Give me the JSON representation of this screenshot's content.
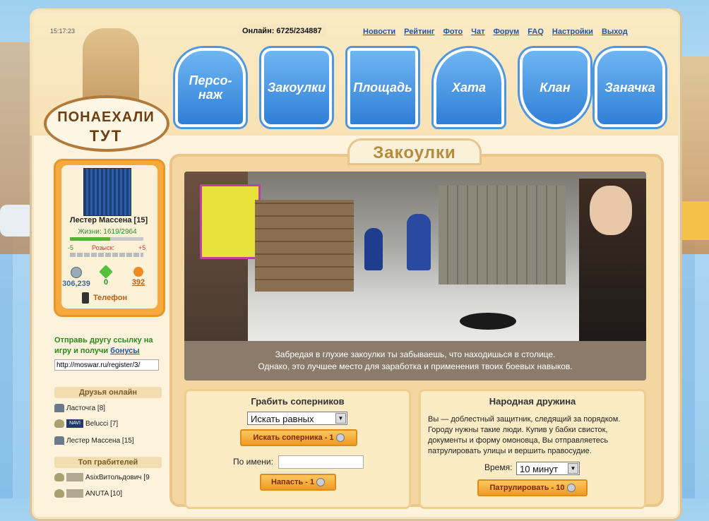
{
  "header": {
    "clock": "15:17:23",
    "online": "Онлайн: 6725/234887",
    "logo_line1": "ПОНАЕХАЛИ",
    "logo_line2": "ТУТ",
    "nav": [
      "Новости",
      "Рейтинг",
      "Фото",
      "Чат",
      "Форум",
      "FAQ",
      "Настройки",
      "Выход"
    ]
  },
  "badges": [
    "Персо-наж",
    "Закоулки",
    "Площадь",
    "Хата",
    "Клан",
    "Заначка"
  ],
  "character": {
    "name": "Лестер Массена [15]",
    "hp_label": "Жизни: 1619/2964",
    "hp_fraction": 0.546,
    "wanted_min": "-5",
    "wanted_label": "Розыск:",
    "wanted_max": "+5",
    "money": "306,239",
    "ore": "0",
    "oil": "392",
    "phone": "Телефон"
  },
  "invite": {
    "text": "Отправь другу ссылку на игру и получи",
    "link": "бонусы",
    "url": "http://moswar.ru/register/3/"
  },
  "friends": {
    "title": "Друзья онлайн",
    "items": [
      {
        "name": "Ласточга [8]"
      },
      {
        "name": "Belucci [7]",
        "tag": "NAVI"
      },
      {
        "name": "Лестер Массена [15]"
      }
    ]
  },
  "robbers": {
    "title": "Топ грабителей",
    "items": [
      {
        "name": "AsixВитольдович [9"
      },
      {
        "name": "ANUTA [10]"
      }
    ]
  },
  "main": {
    "tab_title": "Закоулки",
    "caption_line1": "Забредая в глухие закоулки ты забываешь, что находишься в столице.",
    "caption_line2": "Однако, это лучшее место для заработка и применения твоих боевых навыков."
  },
  "rob": {
    "title": "Грабить соперников",
    "select_value": "Искать равных",
    "search_button": "Искать соперника - 1",
    "by_name_label": "По имени:",
    "attack_button": "Напасть - 1"
  },
  "patrol": {
    "title": "Народная дружина",
    "description": "Вы — доблестный защитник, следящий за порядком. Городу нужны такие люди. Купив у бабки свисток, документы и форму омоновца, Вы отправляетесь патрулировать улицы и вершить правосудие.",
    "time_label": "Время:",
    "time_value": "10 минут",
    "button": "Патрулировать - 10"
  },
  "colors": {
    "accent": "#f09a22",
    "link": "#1f55a7",
    "badge": "#2f7fd8",
    "parchment": "#fdf3dc"
  }
}
